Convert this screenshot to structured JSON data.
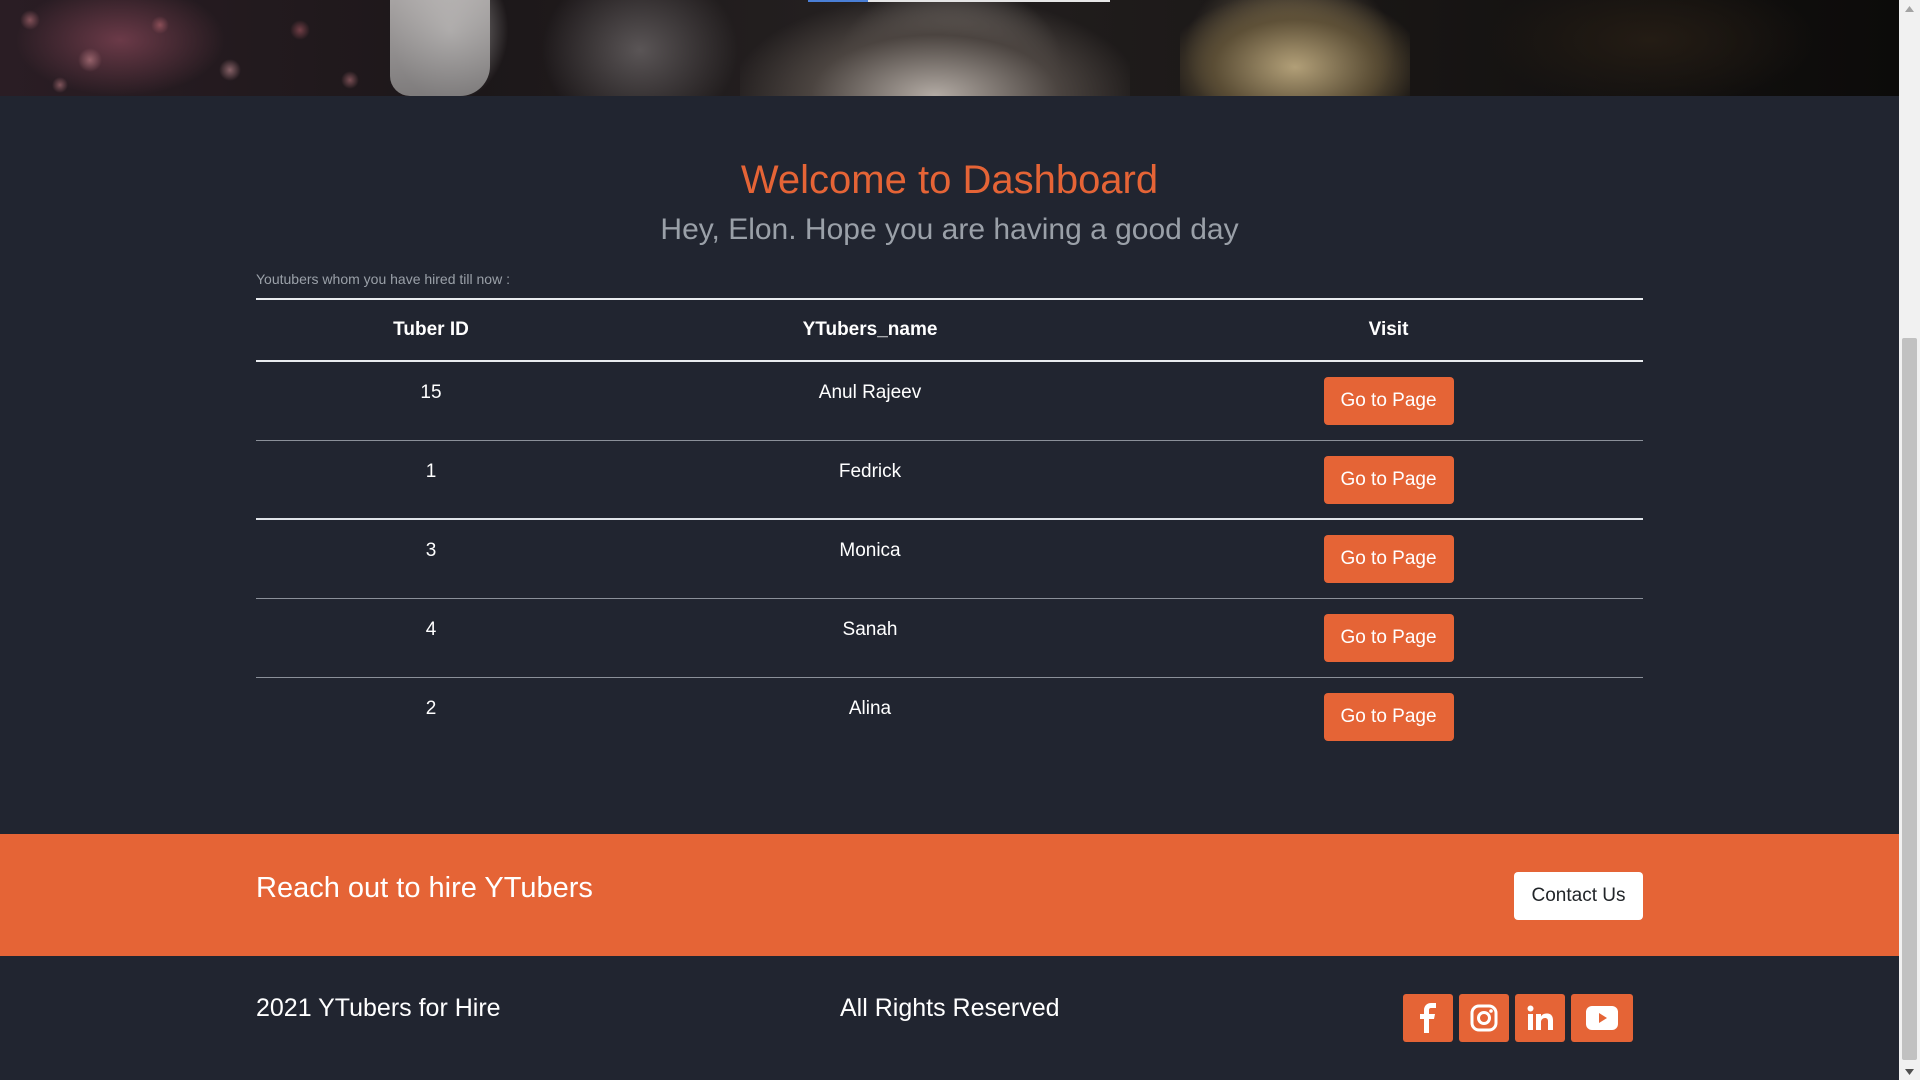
{
  "dashboard": {
    "welcome_title": "Welcome to Dashboard",
    "greeting": "Hey, Elon. Hope you are having a good day",
    "hired_caption": "Youtubers whom you have hired till now :"
  },
  "table": {
    "headers": {
      "id": "Tuber ID",
      "name": "YTubers_name",
      "visit": "Visit"
    },
    "rows": [
      {
        "id": "15",
        "name": "Anul Rajeev",
        "action": "Go to Page"
      },
      {
        "id": "1",
        "name": "Fedrick",
        "action": "Go to Page"
      },
      {
        "id": "3",
        "name": "Monica",
        "action": "Go to Page"
      },
      {
        "id": "4",
        "name": "Sanah",
        "action": "Go to Page"
      },
      {
        "id": "2",
        "name": "Alina",
        "action": "Go to Page"
      }
    ]
  },
  "cta": {
    "text": "Reach out to hire YTubers",
    "button_label": "Contact Us"
  },
  "footer": {
    "copyright": "2021 YTubers for Hire",
    "rights": "All Rights Reserved",
    "social_icons": [
      "facebook-icon",
      "instagram-icon",
      "linkedin-icon",
      "youtube-icon"
    ]
  },
  "colors": {
    "accent": "#e56436",
    "background": "#212530",
    "muted_text": "#9aa0a8"
  }
}
